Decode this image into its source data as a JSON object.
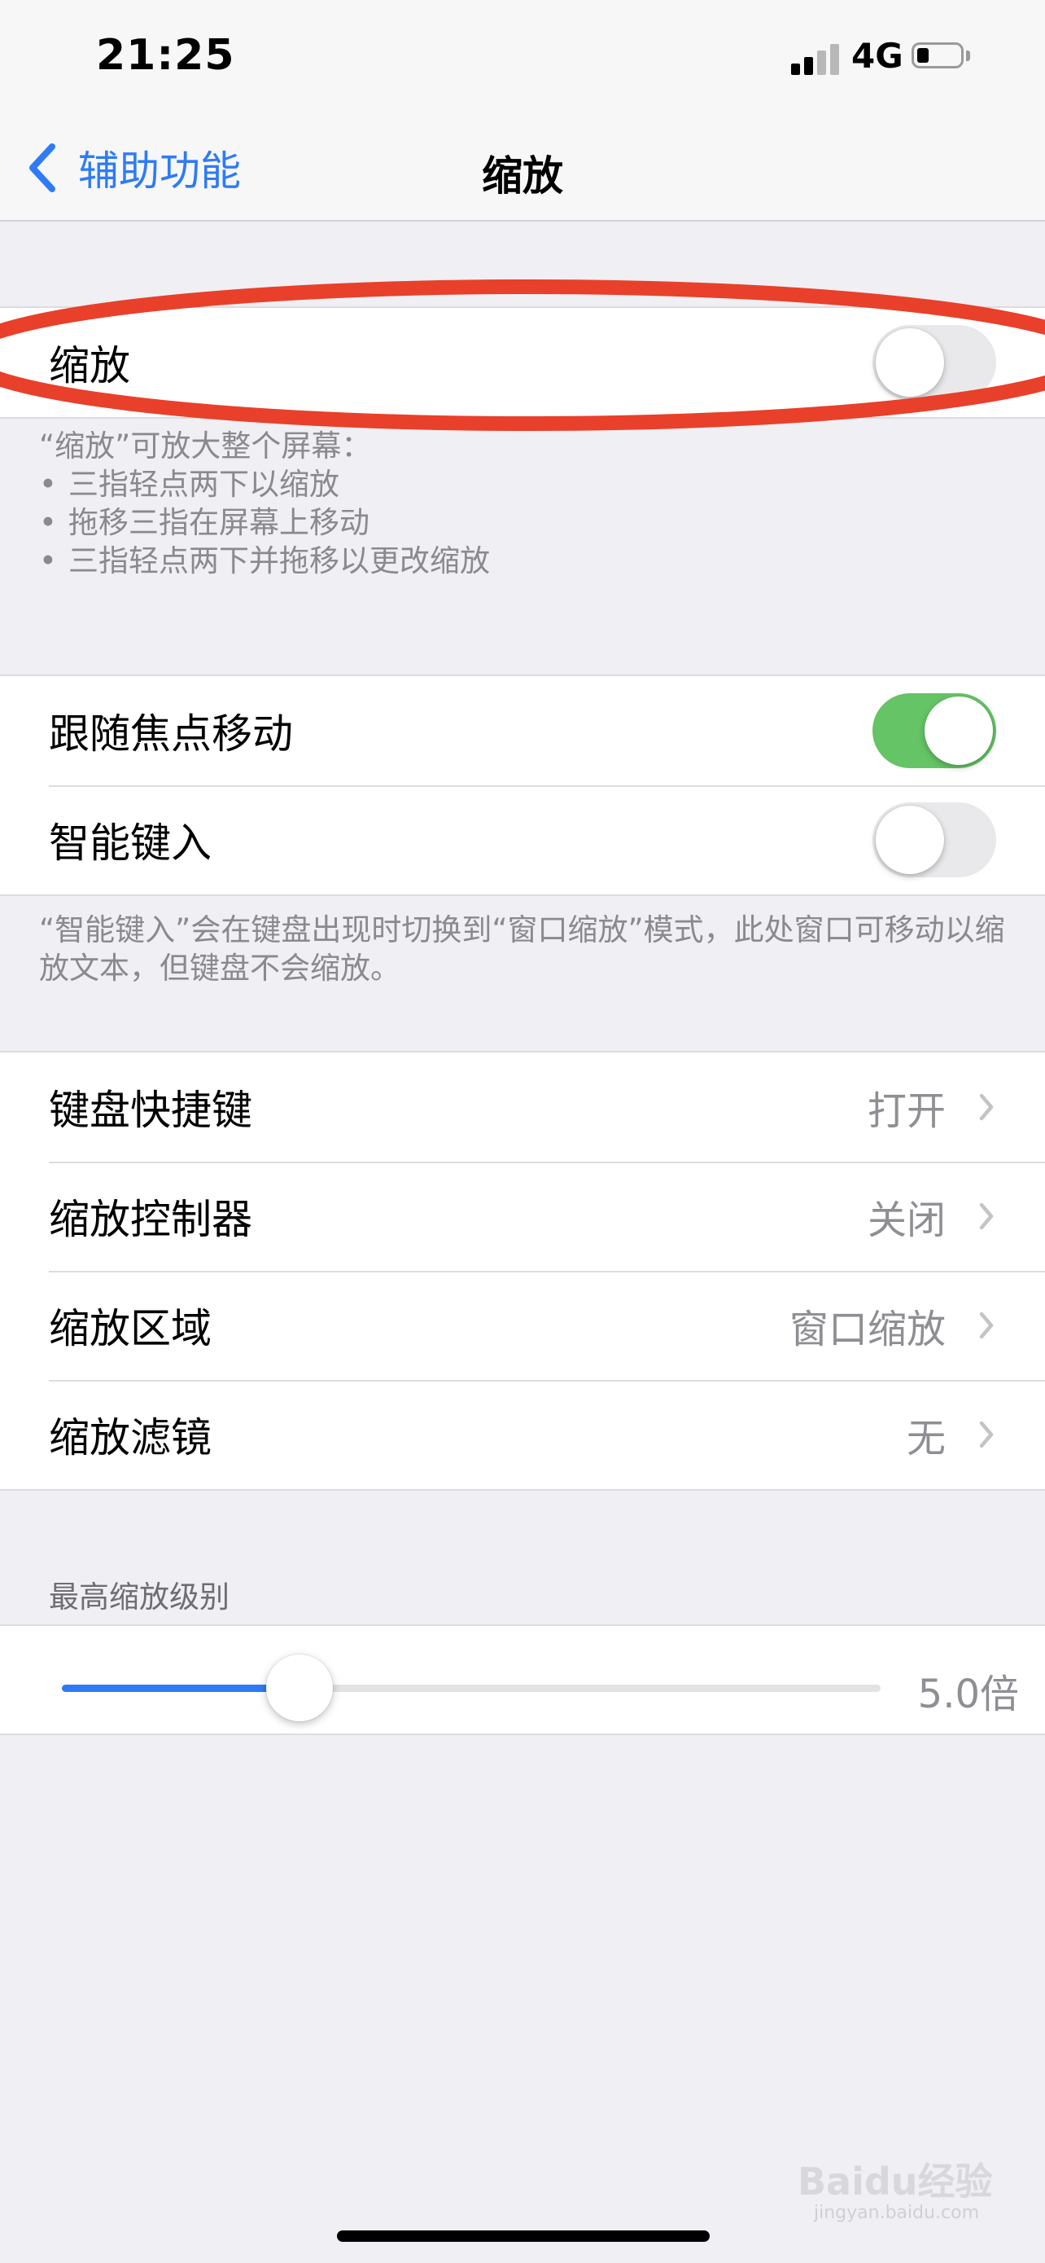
{
  "status_bar": {
    "time": "21:25",
    "network": "4G"
  },
  "nav": {
    "back_label": "辅助功能",
    "title": "缩放"
  },
  "zoom": {
    "label": "缩放",
    "on": false
  },
  "zoom_footer": {
    "intro": "“缩放”可放大整个屏幕：",
    "bullets": [
      "三指轻点两下以缩放",
      "拖移三指在屏幕上移动",
      "三指轻点两下并拖移以更改缩放"
    ]
  },
  "focus_group": {
    "follow_focus": {
      "label": "跟随焦点移动",
      "on": true
    },
    "smart_typing": {
      "label": "智能键入",
      "on": false
    }
  },
  "smart_typing_footer": "“智能键入”会在键盘出现时切换到“窗口缩放”模式，此处窗口可移动以缩放文本，但键盘不会缩放。",
  "settings": [
    {
      "label": "键盘快捷键",
      "value": "打开"
    },
    {
      "label": "缩放控制器",
      "value": "关闭"
    },
    {
      "label": "缩放区域",
      "value": "窗口缩放"
    },
    {
      "label": "缩放滤镜",
      "value": "无"
    }
  ],
  "max_zoom": {
    "header": "最高缩放级别",
    "value_label": "5.0倍",
    "fraction": 0.29
  },
  "annotation": {
    "color": "#e8402a"
  },
  "watermark": {
    "brand": "Baidu经验",
    "url": "jingyan.baidu.com"
  }
}
